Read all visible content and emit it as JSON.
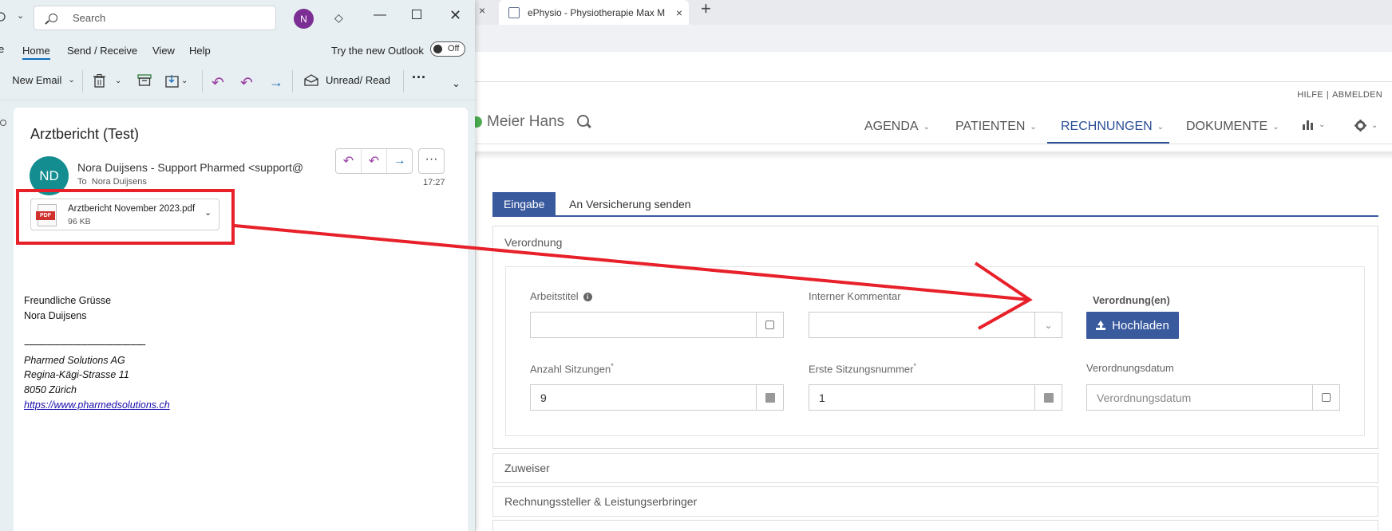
{
  "browser": {
    "tab_title": "ePhysio - Physiotherapie Max M",
    "close_glyph": "×",
    "newtab_glyph": "+"
  },
  "app": {
    "top_links": [
      "HILFE",
      "ABMELDEN"
    ],
    "user_name": "Meier Hans",
    "nav": [
      {
        "label": "AGENDA"
      },
      {
        "label": "PATIENTEN"
      },
      {
        "label": "RECHNUNGEN",
        "active": true
      },
      {
        "label": "DOKUMENTE"
      }
    ],
    "subtabs": [
      "Eingabe",
      "An Versicherung senden"
    ],
    "sections": [
      "Verordnung",
      "Zuweiser",
      "Rechnungssteller & Leistungserbringer"
    ],
    "form": {
      "arbeitstitel_label": "Arbeitstitel",
      "interner_kommentar_label": "Interner Kommentar",
      "verordnungen_label": "Verordnung(en)",
      "upload_button": "Hochladen",
      "anzahl_label": "Anzahl Sitzungen",
      "anzahl_value": "9",
      "erste_label": "Erste Sitzungsnummer",
      "erste_value": "1",
      "datum_label": "Verordnungsdatum",
      "datum_placeholder": "Verordnungsdatum",
      "required_mark": "*"
    }
  },
  "outlook": {
    "search_placeholder": "Search",
    "avatar_initial": "N",
    "menu": [
      "Home",
      "Send / Receive",
      "View",
      "Help"
    ],
    "try_new": "Try the new Outlook",
    "toggle_state": "Off",
    "ribbon": {
      "new_email": "New Email",
      "unread_read": "Unread/ Read",
      "more": "···"
    },
    "message": {
      "subject": "Arztbericht (Test)",
      "sender_initials": "ND",
      "from": "Nora Duijsens - Support Pharmed <support@",
      "to_label": "To",
      "to_name": "Nora Duijsens",
      "time": "17:27",
      "attachment_name": "Arztbericht November 2023.pdf",
      "attachment_size": "96 KB",
      "pdf_badge": "PDF",
      "body": [
        "Freundliche Grüsse",
        "Nora Duijsens",
        "------------------------------------------------"
      ],
      "signature": [
        "Pharmed Solutions AG",
        "Regina-Kägi-Strasse 11",
        "8050 Zürich"
      ],
      "link": "https://www.pharmedsolutions.ch"
    }
  },
  "colors": {
    "accent": "#3a5a9e",
    "annotation_red": "#e8202a",
    "outlook_bg": "#e7eff2",
    "avatar_teal": "#138d90",
    "avatar_purple": "#7b2e93"
  }
}
